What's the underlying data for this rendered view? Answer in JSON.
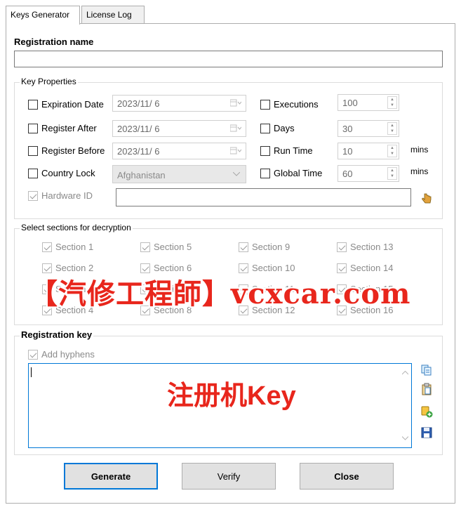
{
  "tabs": [
    {
      "label": "Keys Generator"
    },
    {
      "label": "License Log"
    }
  ],
  "registration": {
    "title": "Registration name",
    "value": ""
  },
  "key_properties": {
    "title": "Key Properties",
    "expiration_date": {
      "label": "Expiration Date",
      "value": "2023/11/  6"
    },
    "register_after": {
      "label": "Register After",
      "value": "2023/11/  6"
    },
    "register_before": {
      "label": "Register Before",
      "value": "2023/11/  6"
    },
    "country_lock": {
      "label": "Country Lock",
      "value": "Afghanistan"
    },
    "hardware_id": {
      "label": "Hardware ID",
      "value": ""
    },
    "executions": {
      "label": "Executions",
      "value": "100"
    },
    "days": {
      "label": "Days",
      "value": "30"
    },
    "run_time": {
      "label": "Run Time",
      "value": "10",
      "unit": "mins"
    },
    "global_time": {
      "label": "Global Time",
      "value": "60",
      "unit": "mins"
    }
  },
  "sections": {
    "title": "Select sections for decryption",
    "items": [
      "Section 1",
      "Section 5",
      "Section 9",
      "Section 13",
      "Section 2",
      "Section 6",
      "Section 10",
      "Section 14",
      "Section 3",
      "Section 7",
      "Section 11",
      "Section 15",
      "Section 4",
      "Section 8",
      "Section 12",
      "Section 16"
    ]
  },
  "key": {
    "title": "Registration key",
    "hyphens_label": "Add hyphens",
    "value": ""
  },
  "buttons": {
    "generate": "Generate",
    "verify": "Verify",
    "close": "Close"
  },
  "watermarks": {
    "site": "【汽修工程師】vcxcar.com",
    "key": "注册机Key"
  },
  "colors": {
    "accent": "#0078d7",
    "watermark": "#e8261c"
  }
}
